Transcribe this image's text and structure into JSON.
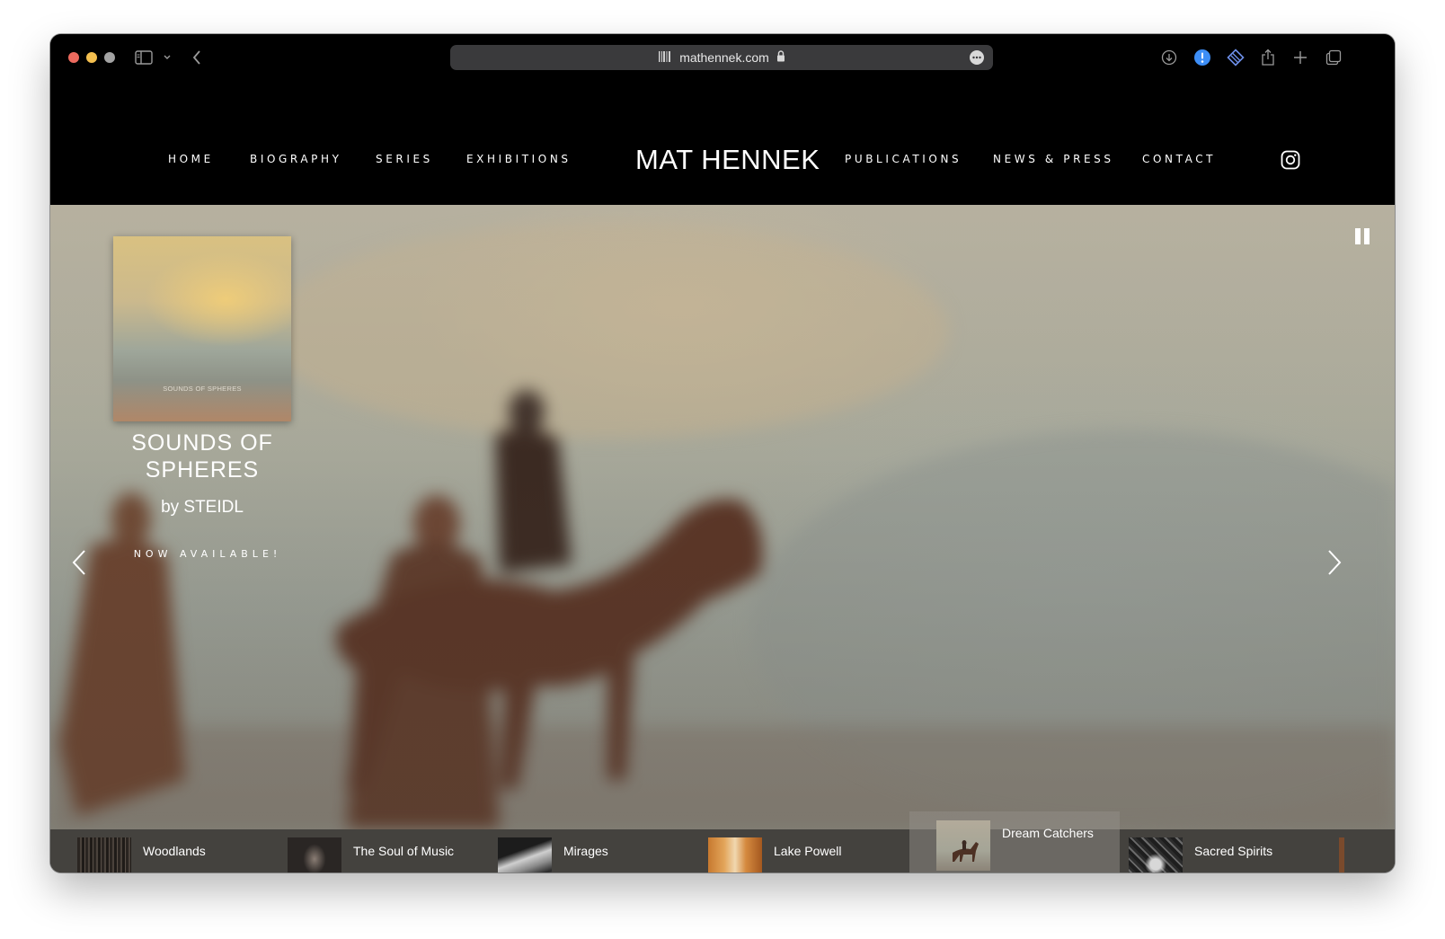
{
  "browser": {
    "url": "mathennek.com",
    "traffic_colors": {
      "close": "#ec6a5e",
      "minimize": "#f4bf4f",
      "maximize": "#a3a3a3"
    },
    "icons": [
      "sidebar-icon",
      "chevron-down-icon",
      "back-icon",
      "reader-icon",
      "lock-icon",
      "more-icon",
      "download-icon",
      "extension-alert-icon",
      "extension-icon",
      "share-icon",
      "new-tab-icon",
      "tab-overview-icon"
    ]
  },
  "site": {
    "logo": "MAT HENNEK",
    "nav_left": [
      "HOME",
      "BIOGRAPHY",
      "SERIES",
      "EXHIBITIONS"
    ],
    "nav_right": [
      "PUBLICATIONS",
      "NEWS & PRESS",
      "CONTACT"
    ],
    "social_icon": "instagram-icon"
  },
  "hero": {
    "book_cover_text": "SOUNDS OF SPHERES",
    "title_line1": "SOUNDS OF",
    "title_line2": "SPHERES",
    "byline": "by STEIDL",
    "cta": "NOW AVAILABLE!",
    "controls": [
      "chevron-left-icon",
      "chevron-right-icon",
      "pause-icon"
    ]
  },
  "thumbnails": [
    {
      "label": "Woodlands",
      "active": false
    },
    {
      "label": "The Soul of Music",
      "active": false
    },
    {
      "label": "Mirages",
      "active": false
    },
    {
      "label": "Lake Powell",
      "active": false
    },
    {
      "label": "Dream Catchers",
      "active": true
    },
    {
      "label": "Sacred Spirits",
      "active": false
    }
  ]
}
